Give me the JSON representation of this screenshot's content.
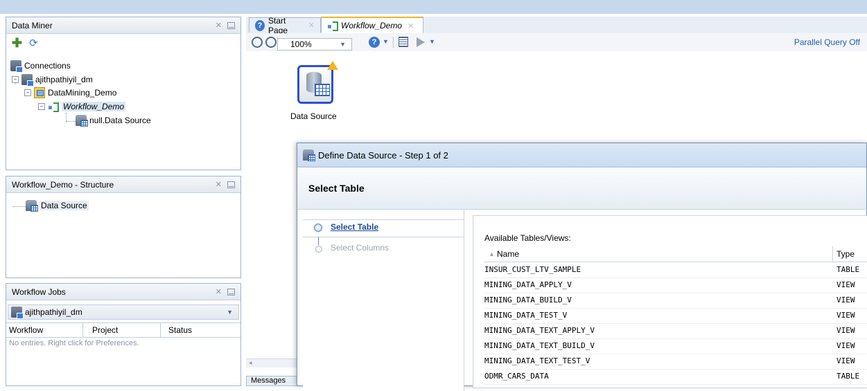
{
  "data_miner": {
    "title": "Data Miner"
  },
  "tree": {
    "connections": "Connections",
    "conn_user": "ajithpathiyil_dm",
    "project": "DataMining_Demo",
    "workflow": "Workflow_Demo",
    "node": "null.Data Source"
  },
  "structure": {
    "title": "Workflow_Demo - Structure",
    "item": "Data Source"
  },
  "jobs": {
    "title": "Workflow Jobs",
    "connection": "ajithpathiyil_dm",
    "columns": [
      "Workflow",
      "Project",
      "Status"
    ],
    "empty": "No entries. Right click for Preferences."
  },
  "tabs": [
    {
      "label": "Start Page",
      "icon": "help-icon"
    },
    {
      "label": "Workflow_Demo",
      "icon": "workflow-icon"
    }
  ],
  "toolbar": {
    "zoom": "100%",
    "parallel_query": "Parallel Query Off"
  },
  "canvas": {
    "node_label": "Data Source"
  },
  "dialog": {
    "title": "Define Data Source - Step 1 of 2",
    "header": "Select Table",
    "steps": [
      "Select Table",
      "Select Columns"
    ],
    "available_label": "Available Tables/Views:",
    "col_name": "Name",
    "col_type": "Type",
    "rows": [
      {
        "name": "INSUR_CUST_LTV_SAMPLE",
        "type": "TABLE"
      },
      {
        "name": "MINING_DATA_APPLY_V",
        "type": "VIEW"
      },
      {
        "name": "MINING_DATA_BUILD_V",
        "type": "VIEW"
      },
      {
        "name": "MINING_DATA_TEST_V",
        "type": "VIEW"
      },
      {
        "name": "MINING_DATA_TEXT_APPLY_V",
        "type": "VIEW"
      },
      {
        "name": "MINING_DATA_TEXT_BUILD_V",
        "type": "VIEW"
      },
      {
        "name": "MINING_DATA_TEXT_TEST_V",
        "type": "VIEW"
      },
      {
        "name": "ODMR_CARS_DATA",
        "type": "TABLE"
      }
    ]
  },
  "messages": {
    "label": "Messages"
  },
  "colors": {
    "accent": "#f0b528",
    "selection": "#d9e6f5",
    "link": "#2a5db0"
  }
}
